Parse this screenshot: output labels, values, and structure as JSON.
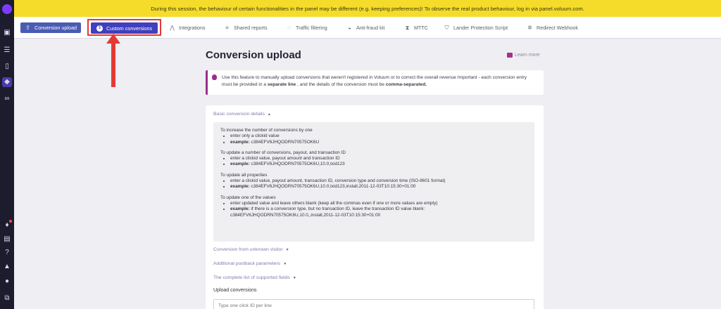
{
  "banner": {
    "text": "During this session, the behaviour of certain functionalities in the panel may be different (e.g. keeping preferences)! To observe the real product behaviour, log in via panel.voluum.com."
  },
  "tabs": [
    {
      "label": "Conversion upload",
      "icon": "upload-icon"
    },
    {
      "label": "Custom conversions",
      "icon": "dollar-icon"
    },
    {
      "label": "Integrations",
      "icon": "share-icon"
    },
    {
      "label": "Shared reports",
      "icon": "report-icon"
    },
    {
      "label": "Traffic filtering",
      "icon": "filter-icon"
    },
    {
      "label": "Anti-fraud kit",
      "icon": "car-icon"
    },
    {
      "label": "MTTC",
      "icon": "hourglass-icon"
    },
    {
      "label": "Lander Protection Script",
      "icon": "shield-icon"
    },
    {
      "label": "Redirect Webhook",
      "icon": "webhook-icon"
    }
  ],
  "page": {
    "title": "Conversion upload",
    "learn_more": "Learn more"
  },
  "info": {
    "part1": "Use this feature to manually upload conversions that weren't registered in Voluum or to correct the overall revenue  Important - each conversion entry must be provided in a ",
    "bold1": "separate line",
    "part2": " , and the details of the conversion must be ",
    "bold2": "comma-separated."
  },
  "sections": {
    "basic": "Basic conversion details",
    "unknown_visitor": "Conversion from unknown visitor",
    "postback": "Additional postback parameters",
    "fields": "The complete list of supported fields"
  },
  "details": [
    {
      "heading": "To increase the number of conversions by one",
      "bullets": [
        {
          "label": "",
          "text": "enter only a clickid value"
        },
        {
          "label": "example:",
          "text": " c384EFV6JHQODRN70575OK6U"
        }
      ]
    },
    {
      "heading": "To update a number of conversions, payout, and transaction ID",
      "bullets": [
        {
          "label": "",
          "text": "enter a clickid value, payout amount and transaction ID"
        },
        {
          "label": "example:",
          "text": " c384EFV6JHQODRN70575OK6U,10.0,txid123"
        }
      ]
    },
    {
      "heading": "To update all properties",
      "bullets": [
        {
          "label": "",
          "text": "enter a clickid value, payout amount, transaction ID, conversion type and conversion time (ISO-8601 format)"
        },
        {
          "label": "example:",
          "text": " c384EFV6JHQODRN70575OK6U,10.0,txid123,install,2011-12-03T10:15:30+01:00"
        }
      ]
    },
    {
      "heading": "To update one of the values",
      "bullets": [
        {
          "label": "",
          "text": "enter updated value and leave others blank (keep all the commas even if one or more values are empty)"
        },
        {
          "label": "example:",
          "text": " if there is a conversion type, but no transaction ID, leave the transaction ID value blank: c384EFV6JHQODRN70575OK6U,10.0,,install,2011-12-03T10:15:30+01:00"
        }
      ]
    }
  ],
  "upload": {
    "label": "Upload conversions",
    "placeholder": "Type one click ID per line"
  },
  "colors": {
    "banner": "#f5dc2a",
    "active_tab": "#3f3fbf",
    "accent": "#9b2f8a",
    "highlight": "#e53935"
  }
}
